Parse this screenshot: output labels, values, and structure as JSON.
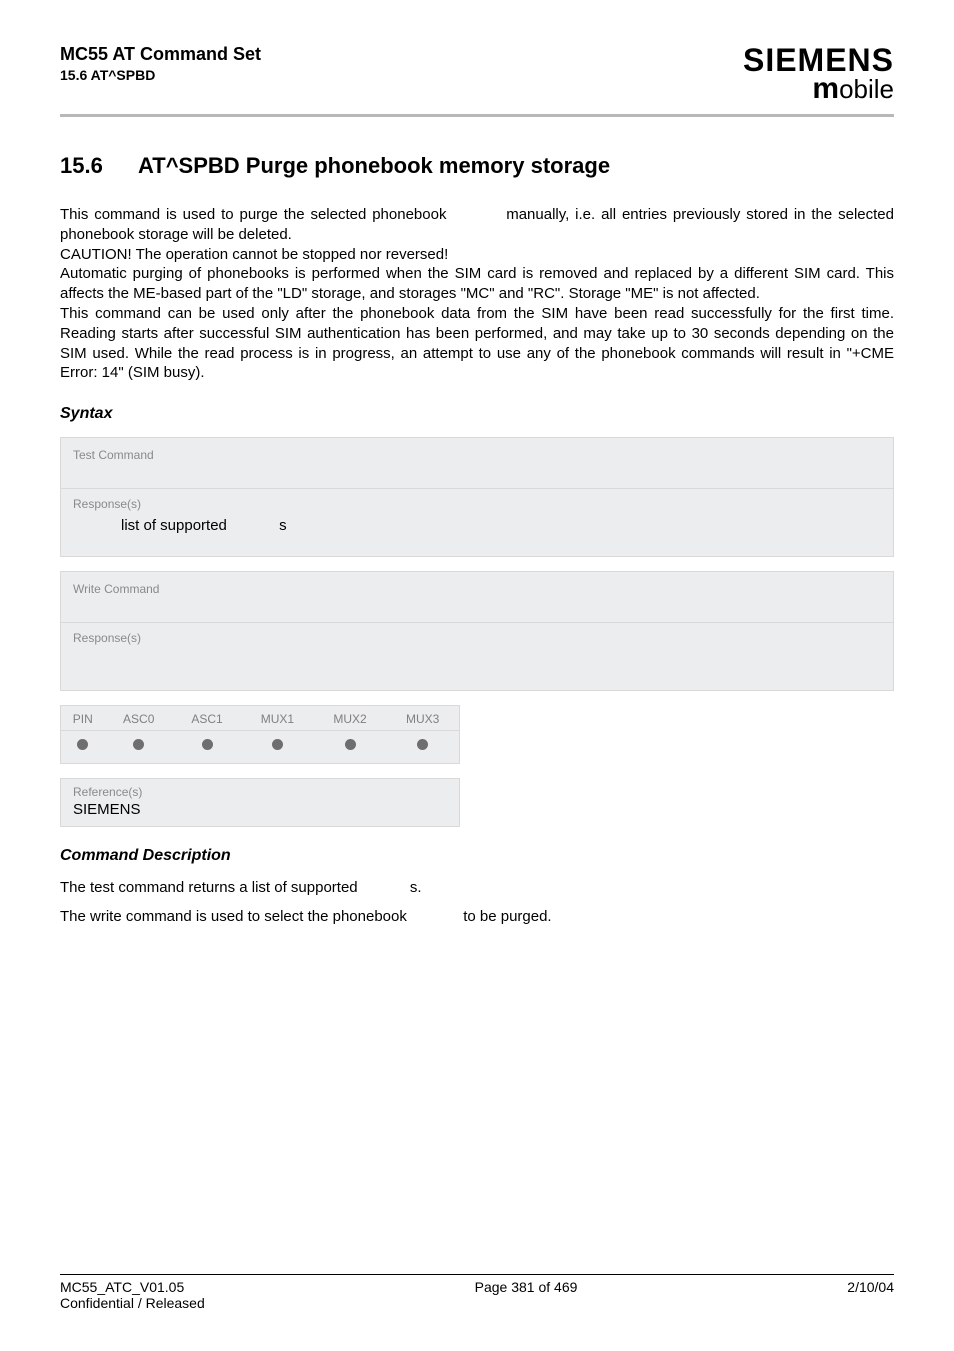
{
  "header": {
    "doc_title": "MC55 AT Command Set",
    "doc_sub": "15.6 AT^SPBD",
    "logo_top": "SIEMENS",
    "logo_bottom_m": "m",
    "logo_bottom_rest": "obile"
  },
  "section": {
    "number": "15.6",
    "title": "AT^SPBD   Purge phonebook memory storage"
  },
  "body": {
    "p1a": "This command is used to purge the selected phonebook ",
    "p1b": " manually, i.e. all entries previously stored in the selected phonebook storage will be deleted.",
    "p2": "CAUTION! The operation cannot be stopped nor reversed!",
    "p3": "Automatic purging of phonebooks is performed when the SIM card is removed and replaced by a different SIM card. This affects the ME-based part of the \"LD\" storage, and storages \"MC\" and \"RC\". Storage \"ME\" is not affected.",
    "p4": "This command can be used only after the phonebook data from the SIM have been read successfully for the first time. Reading starts after successful SIM authentication has been performed, and may take up to 30 seconds depending on the SIM used. While the read process is in progress, an attempt to use any of the phonebook commands will result in \"+CME Error: 14\" (SIM busy)."
  },
  "syntax": {
    "heading": "Syntax",
    "test": {
      "label": "Test Command",
      "response_label": "Response(s)",
      "response_a": "list of supported ",
      "response_b": "s"
    },
    "write": {
      "label": "Write Command",
      "response_label": "Response(s)"
    },
    "caps": {
      "headers": [
        "PIN",
        "ASC0",
        "ASC1",
        "MUX1",
        "MUX2",
        "MUX3"
      ]
    },
    "reference": {
      "label": "Reference(s)",
      "value": "SIEMENS"
    }
  },
  "cmd_desc": {
    "heading": "Command Description",
    "line1a": "The test command returns a list of supported ",
    "line1b": "s.",
    "line2a": "The write command is used to select the phonebook ",
    "line2b": " to be purged."
  },
  "footer": {
    "left1": "MC55_ATC_V01.05",
    "left2": "Confidential / Released",
    "center": "Page 381 of 469",
    "right": "2/10/04"
  }
}
